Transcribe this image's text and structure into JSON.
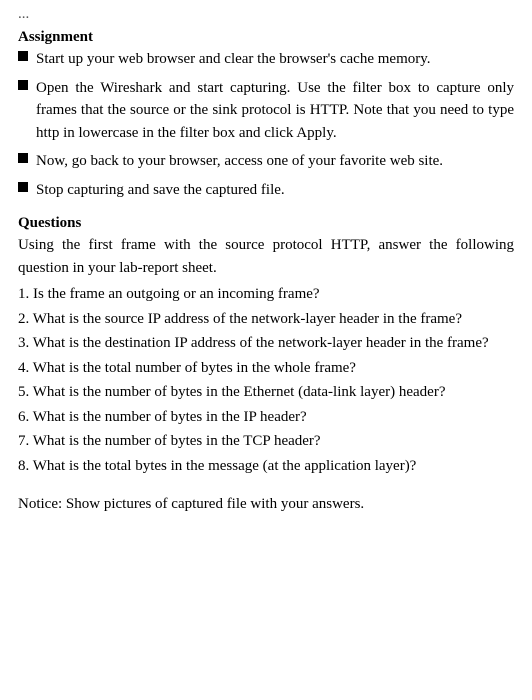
{
  "page": {
    "title": "...",
    "assignment_label": "Assignment",
    "bullets": [
      "Start up your web browser and clear the browser's cache memory.",
      "Open the Wireshark and start capturing. Use the filter box to capture only frames that the source or the sink protocol is HTTP. Note that you need to type http in lowercase in the filter box and click Apply.",
      "Now, go back to your browser, access one of your favorite web site.",
      "Stop capturing and save the captured file."
    ],
    "questions_heading": "Questions",
    "questions_intro": "Using the first frame with the source protocol HTTP, answer the following question in your lab-report sheet.",
    "questions": [
      "1. Is the frame an outgoing or an incoming frame?",
      "2. What is the source IP address of the network-layer header in the frame?",
      "3. What is the destination IP address of the network-layer header in the frame?",
      "4. What is the total number of bytes in the whole frame?",
      "5. What is the number of bytes in the Ethernet (data-link layer) header?",
      "6. What is the number of bytes in the IP header?",
      "7. What is the number of bytes in the TCP header?",
      "8. What is the total bytes in the message (at the application layer)?"
    ],
    "notice": "Notice: Show pictures of captured file with your answers."
  }
}
